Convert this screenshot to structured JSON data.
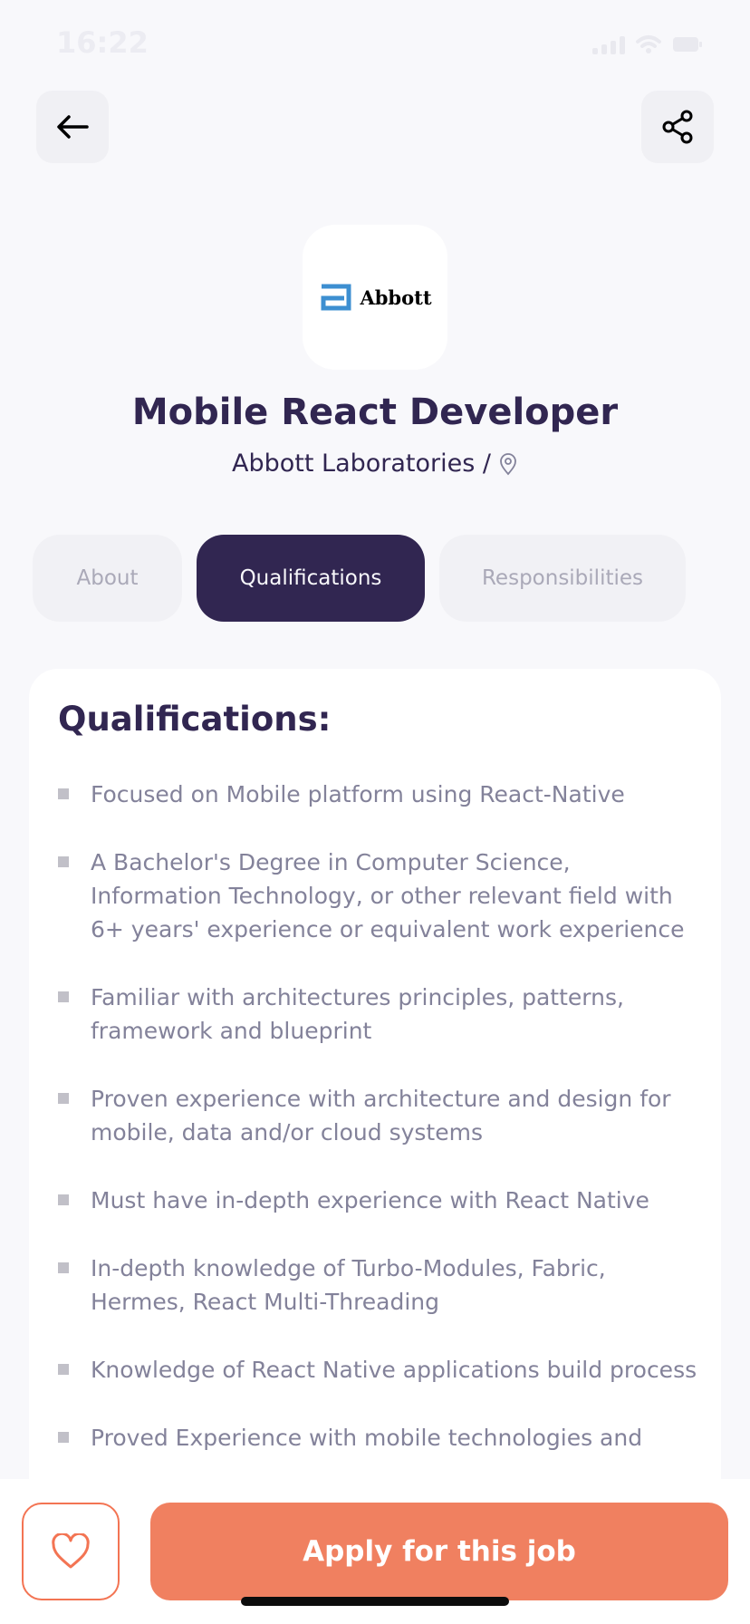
{
  "status_bar": {
    "time": "16:22"
  },
  "header": {
    "back_icon": "arrow-left-icon",
    "share_icon": "share-icon"
  },
  "company": {
    "logo_text": "Abbott",
    "logo_color": "#3D8FD1",
    "name": "Abbott Laboratories /",
    "location_icon": "map-pin-icon"
  },
  "job": {
    "title": "Mobile React Developer"
  },
  "tabs": [
    {
      "label": "About",
      "active": false
    },
    {
      "label": "Qualifications",
      "active": true
    },
    {
      "label": "Responsibilities",
      "active": false
    }
  ],
  "qualifications": {
    "title": "Qualifications:",
    "items": [
      "Focused on Mobile platform using React-Native",
      "A Bachelor's Degree in Computer Science, Information Technology, or other relevant field with 6+ years' experience or equivalent work experience",
      "Familiar with architectures principles, patterns, framework and blueprint",
      "Proven experience with architecture and design for mobile, data and/or cloud systems",
      "Must have in-depth experience with React Native",
      "In-depth knowledge of Turbo-Modules, Fabric, Hermes, React Multi-Threading",
      "Knowledge of React Native applications build process",
      "Proved Experience with mobile technologies and"
    ]
  },
  "footer": {
    "like_icon": "heart-icon",
    "apply_label": "Apply for this job"
  },
  "colors": {
    "primary": "#312651",
    "accent": "#F37453",
    "background": "#F8F8FB"
  }
}
